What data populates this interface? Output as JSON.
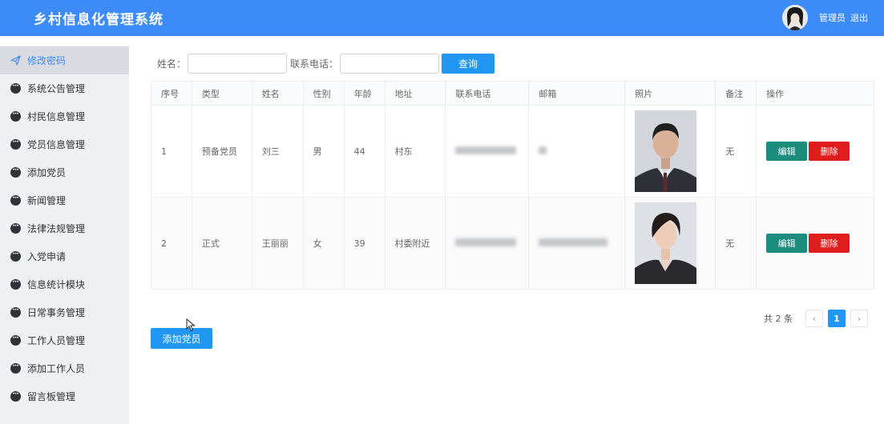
{
  "header": {
    "title": "乡村信息化管理系统",
    "user": "管理员",
    "logout": "退出"
  },
  "sidebar": {
    "items": [
      {
        "label": "修改密码",
        "icon": "send-icon",
        "active": true
      },
      {
        "label": "系统公告管理",
        "icon": "chat-bubble-icon"
      },
      {
        "label": "村民信息管理",
        "icon": "chat-bubble-icon"
      },
      {
        "label": "党员信息管理",
        "icon": "chat-bubble-icon"
      },
      {
        "label": "添加党员",
        "icon": "chat-bubble-icon"
      },
      {
        "label": "新闻管理",
        "icon": "chat-bubble-icon"
      },
      {
        "label": "法律法规管理",
        "icon": "chat-bubble-icon"
      },
      {
        "label": "入党申请",
        "icon": "chat-bubble-icon"
      },
      {
        "label": "信息统计模块",
        "icon": "chat-bubble-icon"
      },
      {
        "label": "日常事务管理",
        "icon": "chat-bubble-icon"
      },
      {
        "label": "工作人员管理",
        "icon": "chat-bubble-icon"
      },
      {
        "label": "添加工作人员",
        "icon": "chat-bubble-icon"
      },
      {
        "label": "留言板管理",
        "icon": "chat-bubble-icon"
      }
    ]
  },
  "search": {
    "name_label": "姓名：",
    "name_value": "",
    "phone_label": "联系电话：",
    "phone_value": "",
    "button": "查询"
  },
  "table": {
    "columns": [
      "序号",
      "类型",
      "姓名",
      "性别",
      "年龄",
      "地址",
      "联系电话",
      "邮箱",
      "照片",
      "备注",
      "操作"
    ],
    "rows": [
      {
        "no": "1",
        "type": "预备党员",
        "name": "刘三",
        "gender": "男",
        "age": "44",
        "address": "村东",
        "remark": "无"
      },
      {
        "no": "2",
        "type": "正式",
        "name": "王丽丽",
        "gender": "女",
        "age": "39",
        "address": "村委附近",
        "remark": "无"
      }
    ],
    "edit": "编辑",
    "delete": "删除"
  },
  "pagination": {
    "total": "共 2 条",
    "current": "1",
    "prev": "‹",
    "next": "›"
  },
  "add_button": "添加党员",
  "colors": {
    "header": "#3c8bf7",
    "primary": "#2196f3",
    "edit": "#1c8c7f",
    "delete": "#e01c1c"
  }
}
